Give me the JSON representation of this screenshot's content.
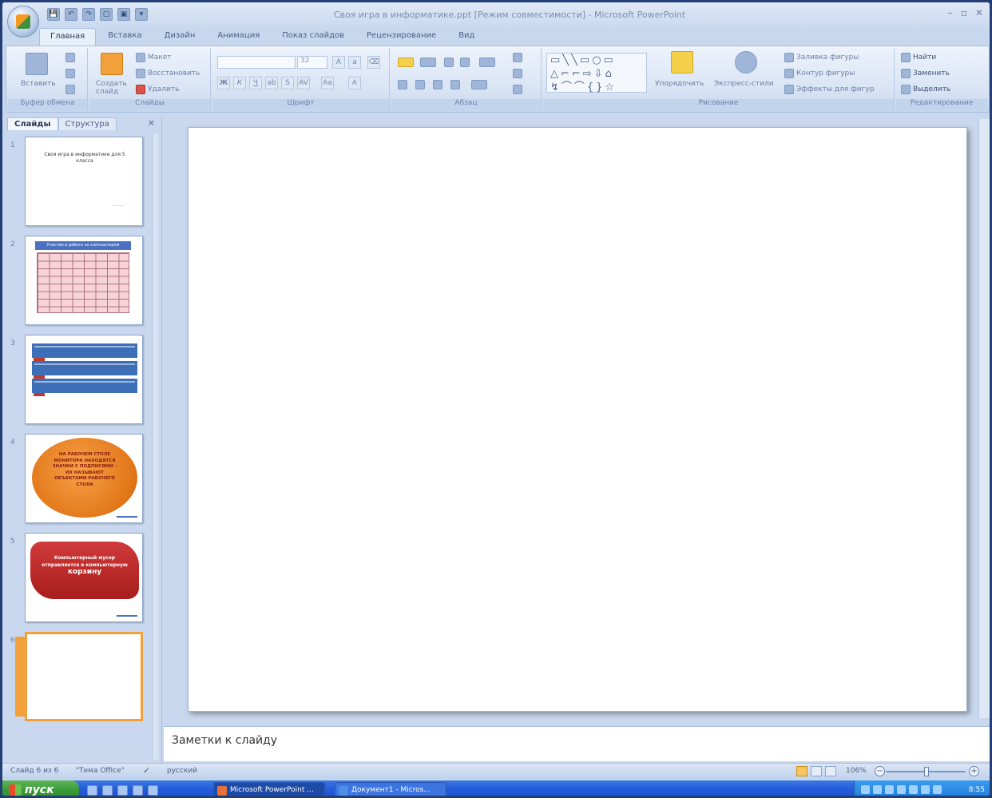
{
  "window": {
    "title": "Своя игра в информатике.ppt [Режим совместимости] - Microsoft PowerPoint",
    "controls": [
      "–",
      "▫",
      "✕"
    ]
  },
  "qat": [
    "💾",
    "↶",
    "↷",
    "▢",
    "▣",
    "▾"
  ],
  "ribbon": {
    "tabs": [
      "Главная",
      "Вставка",
      "Дизайн",
      "Анимация",
      "Показ слайдов",
      "Рецензирование",
      "Вид"
    ],
    "active_tab": 0,
    "groups": {
      "clipboard": {
        "label": "Буфер обмена",
        "paste": "Вставить"
      },
      "slides": {
        "label": "Слайды",
        "new_slide": "Создать слайд",
        "layout": "Макет",
        "reset": "Восстановить",
        "delete": "Удалить"
      },
      "font": {
        "label": "Шрифт",
        "font_name": "",
        "font_size": "32"
      },
      "paragraph": {
        "label": "Абзац"
      },
      "drawing": {
        "label": "Рисование",
        "arrange": "Упорядочить",
        "quick_styles": "Экспресс-стили",
        "fill": "Заливка фигуры",
        "outline": "Контур фигуры",
        "effects": "Эффекты для фигур",
        "shapes_preview": "▭╲╲▭○▭ △⌐⌐⇨⇩⌂ ↯⌒⌒{}☆"
      },
      "editing": {
        "label": "Редактирование",
        "find": "Найти",
        "replace": "Заменить",
        "select": "Выделить"
      }
    }
  },
  "left_pane": {
    "tabs": [
      "Слайды",
      "Структура"
    ],
    "close": "×",
    "slides": [
      {
        "number": "1",
        "title": "Своя игра в информатике для 5 класса",
        "sub": "________"
      },
      {
        "number": "2",
        "header": "Участие в работе за компьютером"
      },
      {
        "number": "3"
      },
      {
        "number": "4",
        "text": "НА РАБОЧЕМ СТОЛЕ МОНИТОРА НАХОДЯТСЯ ЗНАЧКИ С ПОДПИСЯМИ – ИХ НАЗЫВАЮТ ОБЪЕКТАМИ РАБОЧЕГО СТОЛА"
      },
      {
        "number": "5",
        "text": "Компьютерный мусор отправляется в компьютерную",
        "big": "корзину"
      },
      {
        "number": "6"
      }
    ],
    "selected_index": 5
  },
  "notes": {
    "placeholder": "Заметки к слайду"
  },
  "status": {
    "slide": "Слайд 6 из 6",
    "theme": "\"Тема Office\"",
    "lang": "русский",
    "zoom": "106%",
    "zoom_minus": "−",
    "zoom_plus": "+"
  },
  "taskbar": {
    "start": "пуск",
    "tasks": [
      "Microsoft PowerPoint ...",
      "Документ1 - Micros..."
    ],
    "active_task": 0,
    "clock": "8:55"
  }
}
